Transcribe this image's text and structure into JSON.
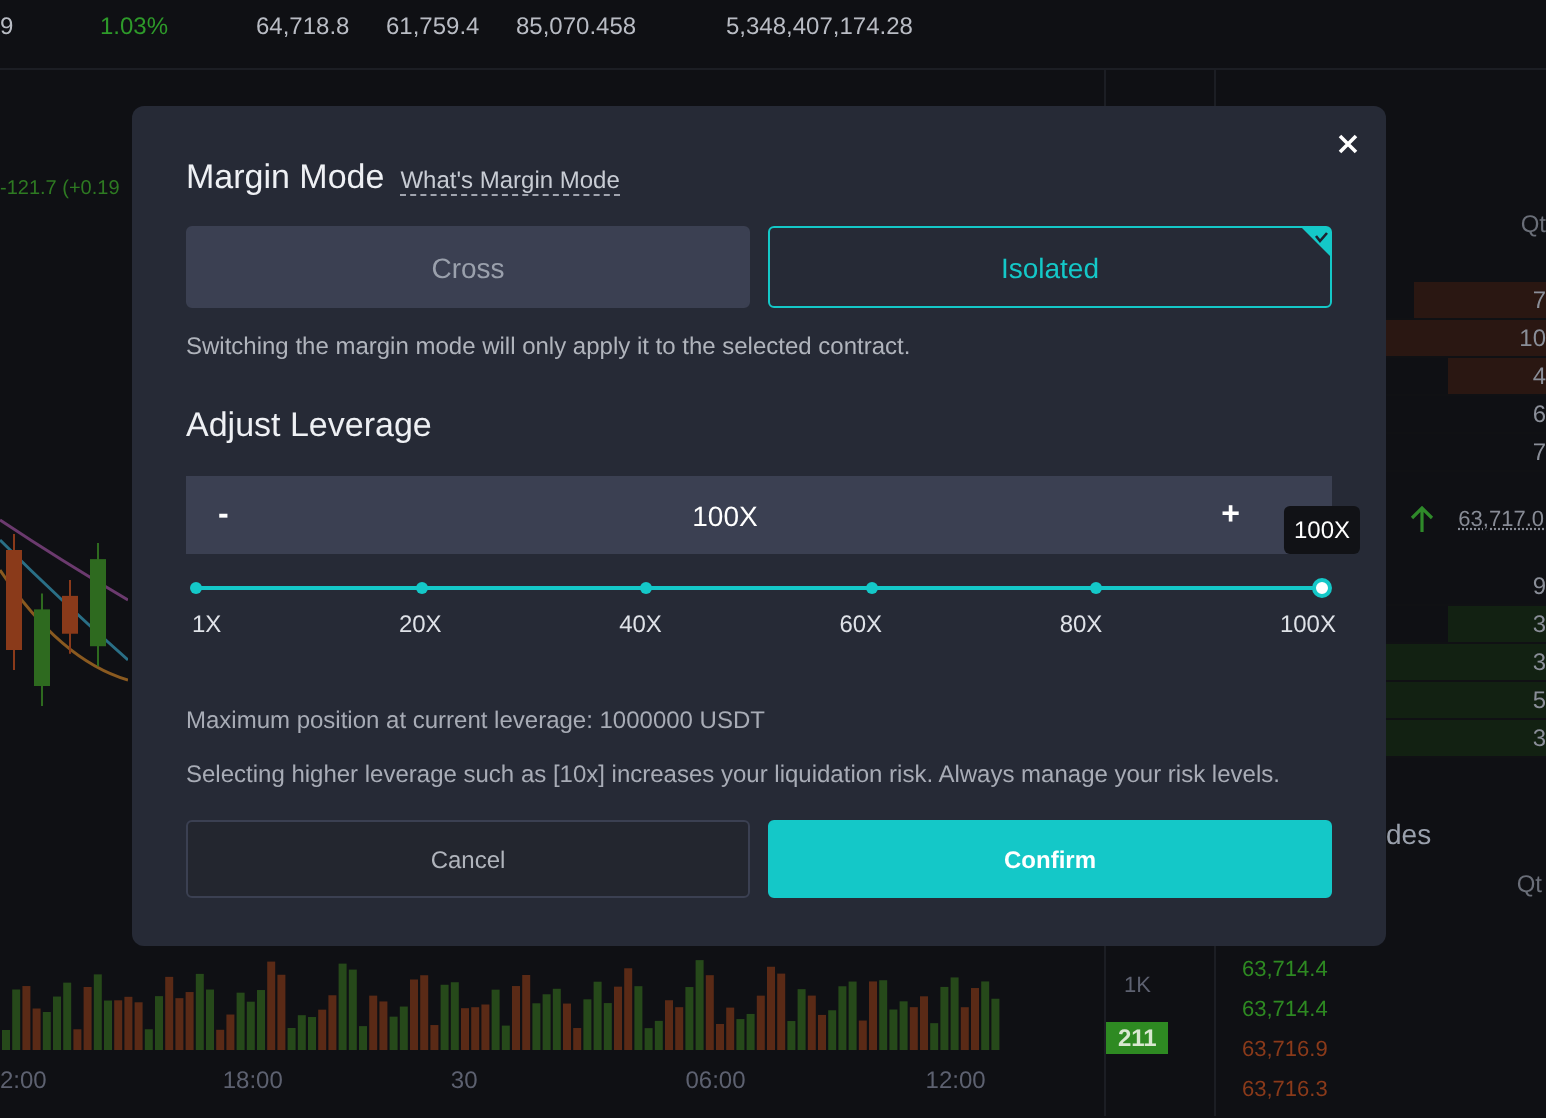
{
  "ticker": [
    {
      "text": "9",
      "kind": "plain"
    },
    {
      "text": "1.03%",
      "kind": "up"
    },
    {
      "text": "64,718.8",
      "kind": "plain"
    },
    {
      "text": "61,759.4",
      "kind": "plain"
    },
    {
      "text": "85,070.458",
      "kind": "plain"
    },
    {
      "text": "5,348,407,174.28",
      "kind": "plain"
    }
  ],
  "chart": {
    "change": "-121.7 (+0.19",
    "time_labels": [
      "2:00",
      "18:00",
      "30",
      "06:00",
      "12:00"
    ]
  },
  "volume_axis": {
    "label": "1K",
    "badge": "211"
  },
  "order_book": {
    "header": "Qt",
    "asks": [
      {
        "qty": "7",
        "level": 0.4
      },
      {
        "qty": "10",
        "level": 0.55
      },
      {
        "qty": "4",
        "level": 0.3
      },
      {
        "qty": "6"
      },
      {
        "qty": "7"
      }
    ],
    "last_price": "63,717.0",
    "bids": [
      {
        "qty": "9"
      },
      {
        "qty": "3",
        "level": 0.3
      },
      {
        "qty": "3",
        "level": 0.6
      },
      {
        "qty": "5",
        "level": 0.85
      },
      {
        "qty": "3",
        "level": 0.85
      }
    ]
  },
  "trades": {
    "title": "des",
    "header": "Qt",
    "prices": [
      {
        "price": "63,714.4",
        "color": "#2e8a22"
      },
      {
        "price": "63,714.4",
        "color": "#2e8a22"
      },
      {
        "price": "63,716.9",
        "color": "#8a3a1a"
      },
      {
        "price": "63,716.3",
        "color": "#8a3a1a"
      }
    ]
  },
  "modal": {
    "title": "Margin Mode",
    "help_link": "What's Margin Mode",
    "modes": [
      {
        "label": "Cross",
        "selected": false
      },
      {
        "label": "Isolated",
        "selected": true
      }
    ],
    "mode_note": "Switching the margin mode will only apply it to the selected contract.",
    "leverage_title": "Adjust Leverage",
    "stepper": {
      "minus": "-",
      "value": "100X",
      "plus": "+"
    },
    "slider": {
      "level": 1,
      "tooltip": "100X",
      "marks": [
        "1X",
        "20X",
        "40X",
        "60X",
        "80X",
        "100X"
      ]
    },
    "max_position": "Maximum position at current leverage: 1000000 USDT",
    "warning": "Selecting higher leverage such as [10x] increases your liquidation risk. Always manage your risk levels.",
    "buttons": [
      {
        "label": "Cancel",
        "kind": "secondary"
      },
      {
        "label": "Confirm",
        "kind": "primary"
      }
    ]
  }
}
